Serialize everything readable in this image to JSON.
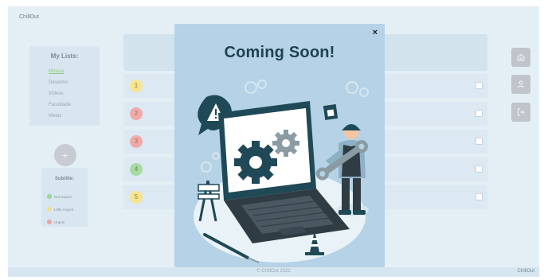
{
  "app": {
    "brand": "ChillOut",
    "footer_copy": "© ChillOut 2022",
    "footer_brand": "ChillOut"
  },
  "lists": {
    "title": "My Lists:",
    "items": [
      {
        "label": "Música",
        "active": true
      },
      {
        "label": "Desenho",
        "active": false
      },
      {
        "label": "Vídeos",
        "active": false
      },
      {
        "label": "Faculdade",
        "active": false
      },
      {
        "label": "Metas",
        "active": false
      }
    ],
    "add_label": "+"
  },
  "subtitle": {
    "title": "Subtitle:",
    "items": [
      {
        "label": "Not Urgent",
        "color": "#9ed39a"
      },
      {
        "label": "Little Urgent",
        "color": "#f1df8a"
      },
      {
        "label": "Urgent",
        "color": "#f0a3a3"
      }
    ]
  },
  "tasks": [
    {
      "priority": "1",
      "color": "#f6e58e"
    },
    {
      "priority": "2",
      "color": "#f2a9a9"
    },
    {
      "priority": "3",
      "color": "#f2a9a9"
    },
    {
      "priority": "4",
      "color": "#a6dba1"
    },
    {
      "priority": "5",
      "color": "#f6e58e"
    }
  ],
  "side_buttons": [
    {
      "name": "home-button",
      "icon": "home-icon"
    },
    {
      "name": "profile-button",
      "icon": "user-icon"
    },
    {
      "name": "logout-button",
      "icon": "logout-icon"
    }
  ],
  "modal": {
    "title": "Coming Soon!",
    "close_label": "×"
  }
}
